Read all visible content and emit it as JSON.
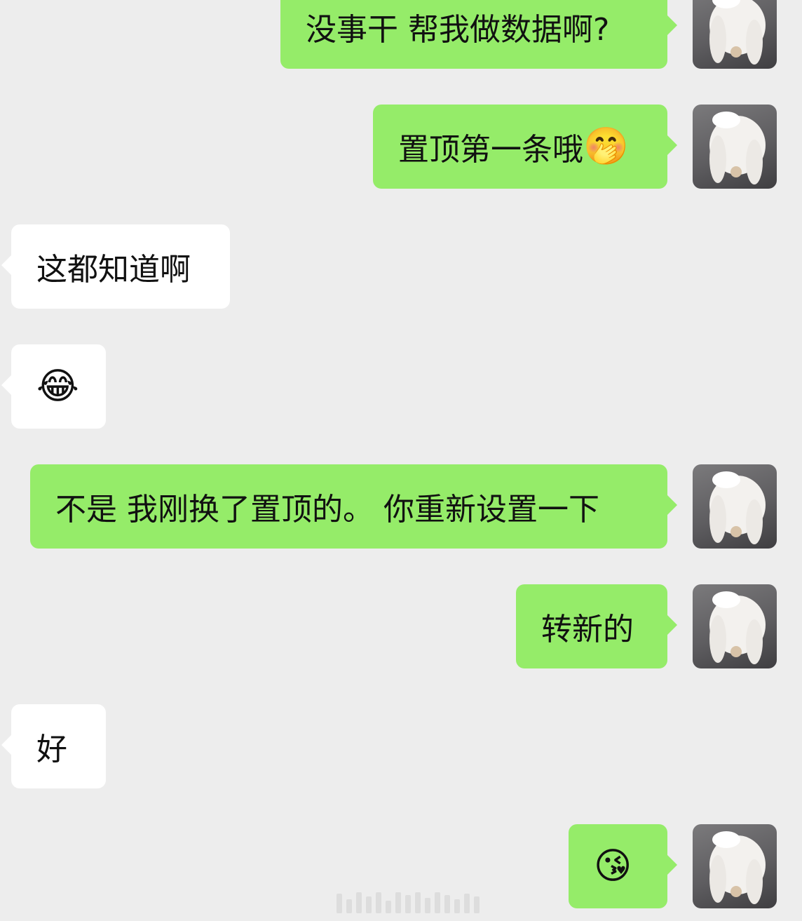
{
  "messages": [
    {
      "side": "out",
      "text": "没事干  帮我做数据啊?",
      "emoji": ""
    },
    {
      "side": "out",
      "text": "置顶第一条哦",
      "emoji": "🤭"
    },
    {
      "side": "in",
      "text": "这都知道啊",
      "emoji": ""
    },
    {
      "side": "in",
      "text": "",
      "emoji": "😂"
    },
    {
      "side": "out",
      "text": "不是 我刚换了置顶的。 你重新设置一下",
      "emoji": ""
    },
    {
      "side": "out",
      "text": "转新的",
      "emoji": ""
    },
    {
      "side": "in",
      "text": "好",
      "emoji": ""
    },
    {
      "side": "out",
      "text": "",
      "emoji": "😘"
    }
  ],
  "avatar": {
    "icon": "white-rabbit-avatar-icon"
  },
  "colors": {
    "background": "#ededed",
    "outgoing_bubble": "#95ec69",
    "incoming_bubble": "#ffffff",
    "text": "#111111"
  }
}
